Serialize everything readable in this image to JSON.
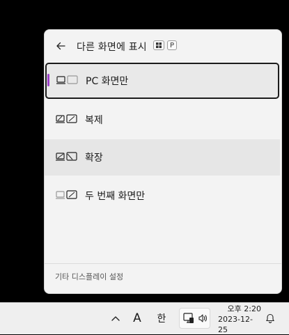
{
  "flyout": {
    "title": "다른 화면에 표시",
    "shortcut_key": "P",
    "options": [
      {
        "label": "PC 화면만",
        "icon": "pc-screen-only-icon",
        "selected": true
      },
      {
        "label": "복제",
        "icon": "duplicate-icon",
        "selected": false
      },
      {
        "label": "확장",
        "icon": "extend-icon",
        "selected": false
      },
      {
        "label": "두 번째 화면만",
        "icon": "second-screen-only-icon",
        "selected": false
      }
    ],
    "footer_link": "기타 디스플레이 설정"
  },
  "taskbar": {
    "input_indicator_a": "A",
    "input_indicator_han": "한",
    "time": "오후 2:20",
    "date": "2023-12-25"
  },
  "colors": {
    "accent": "#9b3fc7",
    "panel": "#f3f3f3",
    "background": "#000000"
  }
}
